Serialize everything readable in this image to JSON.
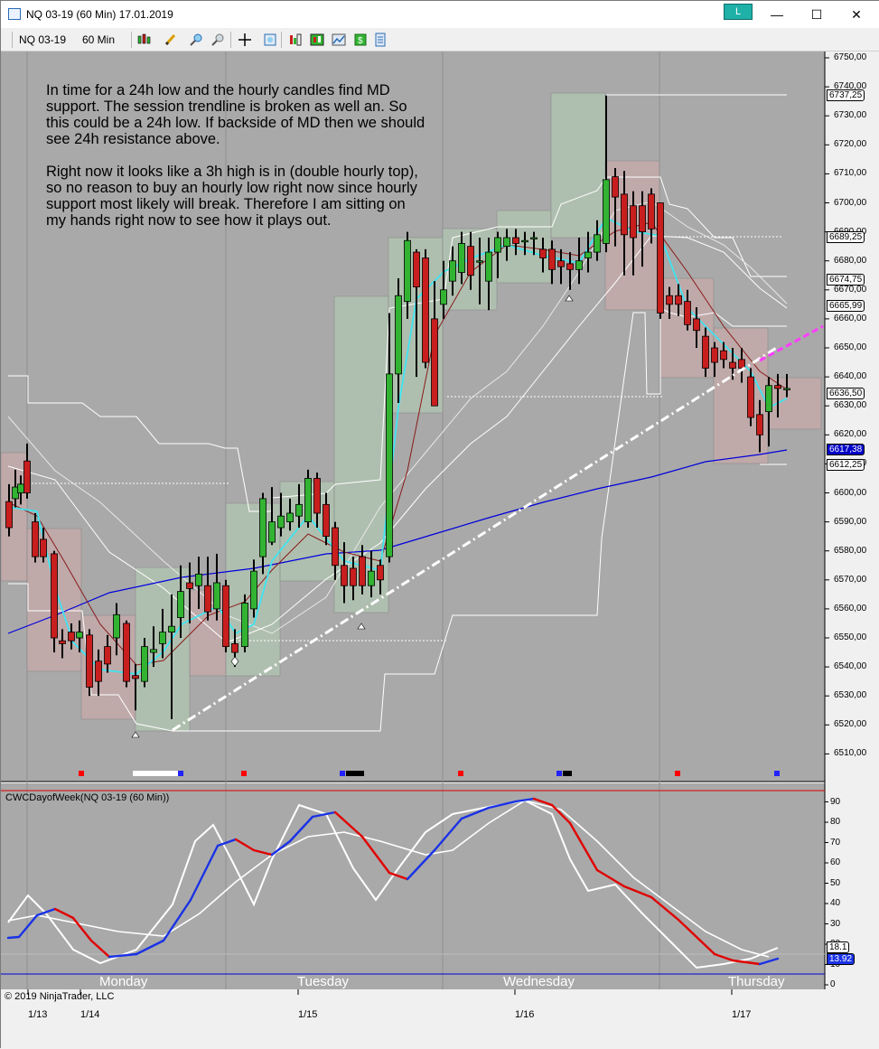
{
  "window": {
    "title": "NQ 03-19 (60 Min)  17.01.2019",
    "link_button_label": "L",
    "minimize_label": "—",
    "maximize_label": "☐",
    "close_label": "✕"
  },
  "toolbar": {
    "instrument": "NQ 03-19",
    "interval": "60 Min"
  },
  "annotation": {
    "paragraph1": "In time for a 24h low and the hourly candles find MD support. The session trendline is broken as well an. So this could be a 24h low. If backside of MD then we should see 24h resistance above.",
    "paragraph2": "Right now it looks like a 3h high is in (double hourly top), so no reason to buy an hourly low right now since hourly support most likely will break. Therefore I am sitting on my hands right now to see how it plays out."
  },
  "indicator_panel": {
    "title": "CWCDayofWeek(NQ 03-19 (60 Min))",
    "axis_labels": [
      "90",
      "80",
      "70",
      "60",
      "50",
      "40",
      "30",
      "20",
      "10",
      "0"
    ],
    "value_boxes": [
      "18.1",
      "13.92"
    ]
  },
  "day_labels": [
    "Monday",
    "Tuesday",
    "Wednesday",
    "Thursday"
  ],
  "date_labels": [
    "1/13",
    "1/14",
    "1/15",
    "1/16",
    "1/17"
  ],
  "copyright": "© 2019 NinjaTrader, LLC",
  "price_axis": {
    "labels": [
      "6750,00",
      "6740,00",
      "6730,00",
      "6720,00",
      "6710,00",
      "6700,00",
      "6690,00",
      "6680,00",
      "6670,00",
      "6660,00",
      "6650,00",
      "6640,00",
      "6630,00",
      "6620,00",
      "6610,00",
      "6600,00",
      "6590,00",
      "6580,00",
      "6570,00",
      "6560,00",
      "6550,00",
      "6540,00",
      "6530,00",
      "6520,00",
      "6510,00"
    ],
    "price_boxes": [
      {
        "label": "6737,25",
        "color": "#ffffff"
      },
      {
        "label": "6689,25",
        "color": "#ffffff"
      },
      {
        "label": "6674,75",
        "color": "#ffffff"
      },
      {
        "label": "6665,99",
        "color": "#ffffff"
      },
      {
        "label": "6636,50",
        "color": "#ffffff"
      },
      {
        "label": "6617,38",
        "color": "#0000c8"
      },
      {
        "label": "6612,25",
        "color": "#ffffff"
      }
    ]
  },
  "colors": {
    "chart_background": "#a9a9a9",
    "bull_candle": "#32b432",
    "bear_candle": "#c81e1e",
    "bull_box": "#b4d2b4",
    "bear_box": "#d2aaaa",
    "ma_blue": "#0000dc",
    "ma_cyan": "#3ee4f0",
    "ma_darkred": "#8b1a1a",
    "trendline_white": "#ffffff",
    "trendline_magenta": "#ff3cff",
    "osc_red": "#e00000",
    "osc_blue": "#1a32e6"
  }
}
